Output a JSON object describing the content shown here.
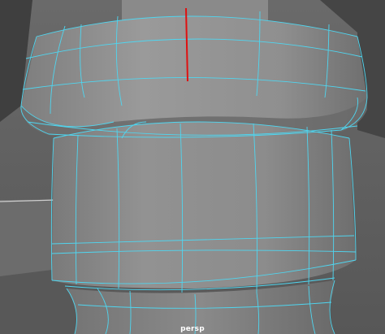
{
  "viewport": {
    "camera_name": "persp",
    "background_color": "#5f5f5f",
    "wireframe_color": "#4fd6f0",
    "selected_edge_color": "#e01010",
    "surface_color": "#8c8c8c"
  }
}
